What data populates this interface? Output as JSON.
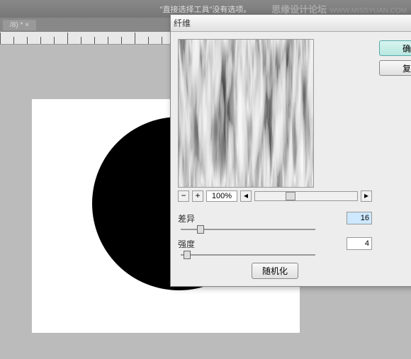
{
  "topbar": {
    "text": "\"直接选择工具\"没有选项。"
  },
  "watermark": {
    "big": "思缘设计论坛",
    "small": "WWW.MISSYUAN.COM"
  },
  "tab": {
    "label": "/8) * ×"
  },
  "dialog": {
    "title": "纤维",
    "ok": "确定",
    "reset": "复位",
    "zoom": "100%",
    "variance_label": "差异",
    "variance_value": "16",
    "strength_label": "强度",
    "strength_value": "4",
    "randomize": "随机化"
  }
}
